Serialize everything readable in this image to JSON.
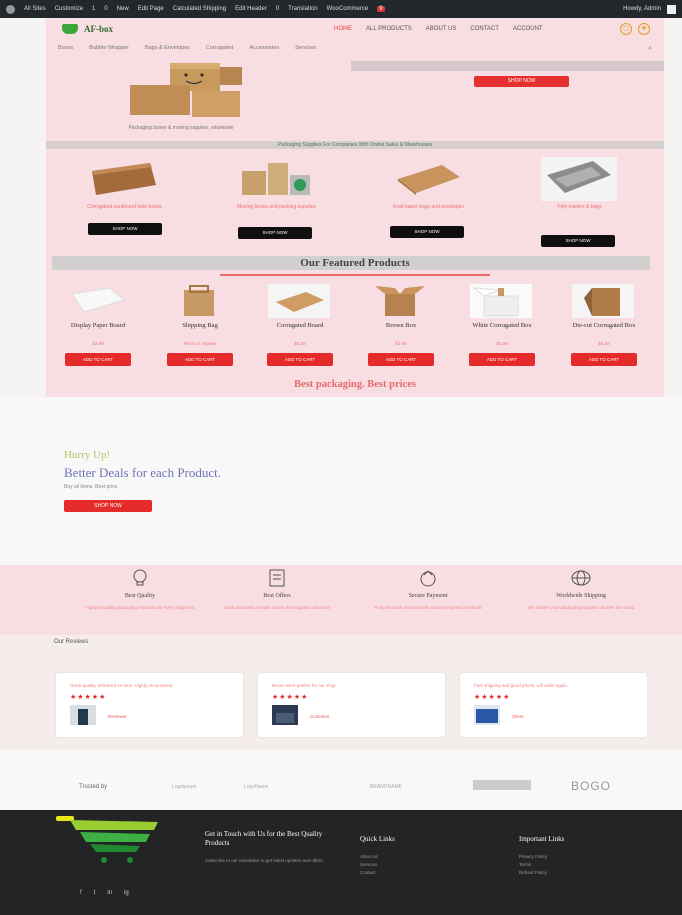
{
  "admin_bar": {
    "items": [
      "All Sites",
      "Customize",
      "1",
      "0",
      "New",
      "Edit Page",
      "Calculated Shipping",
      "Edit Header",
      "0",
      "Translation",
      "WooCommerce"
    ],
    "badge": "9",
    "user": "Howdy, Admin"
  },
  "header": {
    "logo_text": "AF-box",
    "nav": [
      "HOME",
      "ALL PRODUCTS",
      "ABOUT US",
      "CONTACT",
      "ACCOUNT"
    ],
    "categories": [
      "Boxes",
      "Bubble Wrapper",
      "Bags & Envelopes",
      "Corrugated",
      "Accessories",
      "Services"
    ]
  },
  "hero": {
    "button_label": "SHOP NOW",
    "caption": "Packaging boxes & moving supplies, wholesale"
  },
  "category_strip": "Packaging Supplies For Companies With Online Sales & Warehouses",
  "categories": [
    {
      "title": "Corrugated cardboard tube boxes",
      "button": "SHOP NOW"
    },
    {
      "title": "Moving boxes and packing supplies",
      "button": "SHOP NOW"
    },
    {
      "title": "Kraft paper bags and envelopes",
      "button": "SHOP NOW"
    },
    {
      "title": "Poly mailers & bags",
      "button": "SHOP NOW"
    }
  ],
  "featured": {
    "title": "Our Featured Products",
    "products": [
      {
        "name": "Display Paper Board",
        "price": "$2.99",
        "button": "ADD TO CART"
      },
      {
        "name": "Shipping Bag",
        "price": "Price on request",
        "button": "ADD TO CART"
      },
      {
        "name": "Corrugated Board",
        "price": "$3.49",
        "button": "ADD TO CART"
      },
      {
        "name": "Brown Box",
        "price": "$1.99",
        "button": "ADD TO CART"
      },
      {
        "name": "White Corrugated Box",
        "price": "$4.99",
        "button": "ADD TO CART"
      },
      {
        "name": "Die-cut Corrugated Box",
        "price": "$5.49",
        "button": "ADD TO CART"
      }
    ],
    "slogan": "Best packaging. Best prices"
  },
  "deals": {
    "eyebrow": "Hurry Up!",
    "headline": "Better Deals for each Product.",
    "sub": "Buy all items, Best price.",
    "button": "SHOP NOW"
  },
  "features": [
    {
      "icon": "bulb-icon",
      "title": "Best Quality",
      "text": "Highest quality packaging materials for every shipment"
    },
    {
      "icon": "offer-icon",
      "title": "Best Offers",
      "text": "Great discounts on bulk orders and regular customers"
    },
    {
      "icon": "payment-icon",
      "title": "Secure Payment",
      "text": "Fully secured checkout with trusted payment methods"
    },
    {
      "icon": "globe-icon",
      "title": "Worldwide Shipping",
      "text": "We deliver your packaging supplies all over the world"
    }
  ],
  "reviews": {
    "title": "Our Reviews",
    "items": [
      {
        "text": "Great quality, delivered on time. Highly recommend.",
        "stars": "★★★★★",
        "name": "Reviewer"
      },
      {
        "text": "Boxes were perfect for our shop.",
        "stars": "★★★★★",
        "name": "Customer"
      },
      {
        "text": "Fast shipping and good prices, will order again.",
        "stars": "★★★★★",
        "name": "Client"
      }
    ]
  },
  "partners": {
    "label": "Trusted by",
    "names": [
      "Logoipsum",
      "LogoName",
      "BRANDNAME"
    ],
    "last": "BOGO"
  },
  "footer": {
    "touch_title": "Get in Touch with Us for the Best Quality Products",
    "touch_sub": "Subscribe to our newsletter to get latest updates and offers.",
    "quick_title": "Quick Links",
    "quick_links": [
      "About us",
      "Services",
      "Contact"
    ],
    "important_title": "Important Links",
    "important_links": [
      "Privacy Policy",
      "Terms",
      "Refund Policy"
    ],
    "social": [
      "f",
      "t",
      "in",
      "ig"
    ]
  }
}
